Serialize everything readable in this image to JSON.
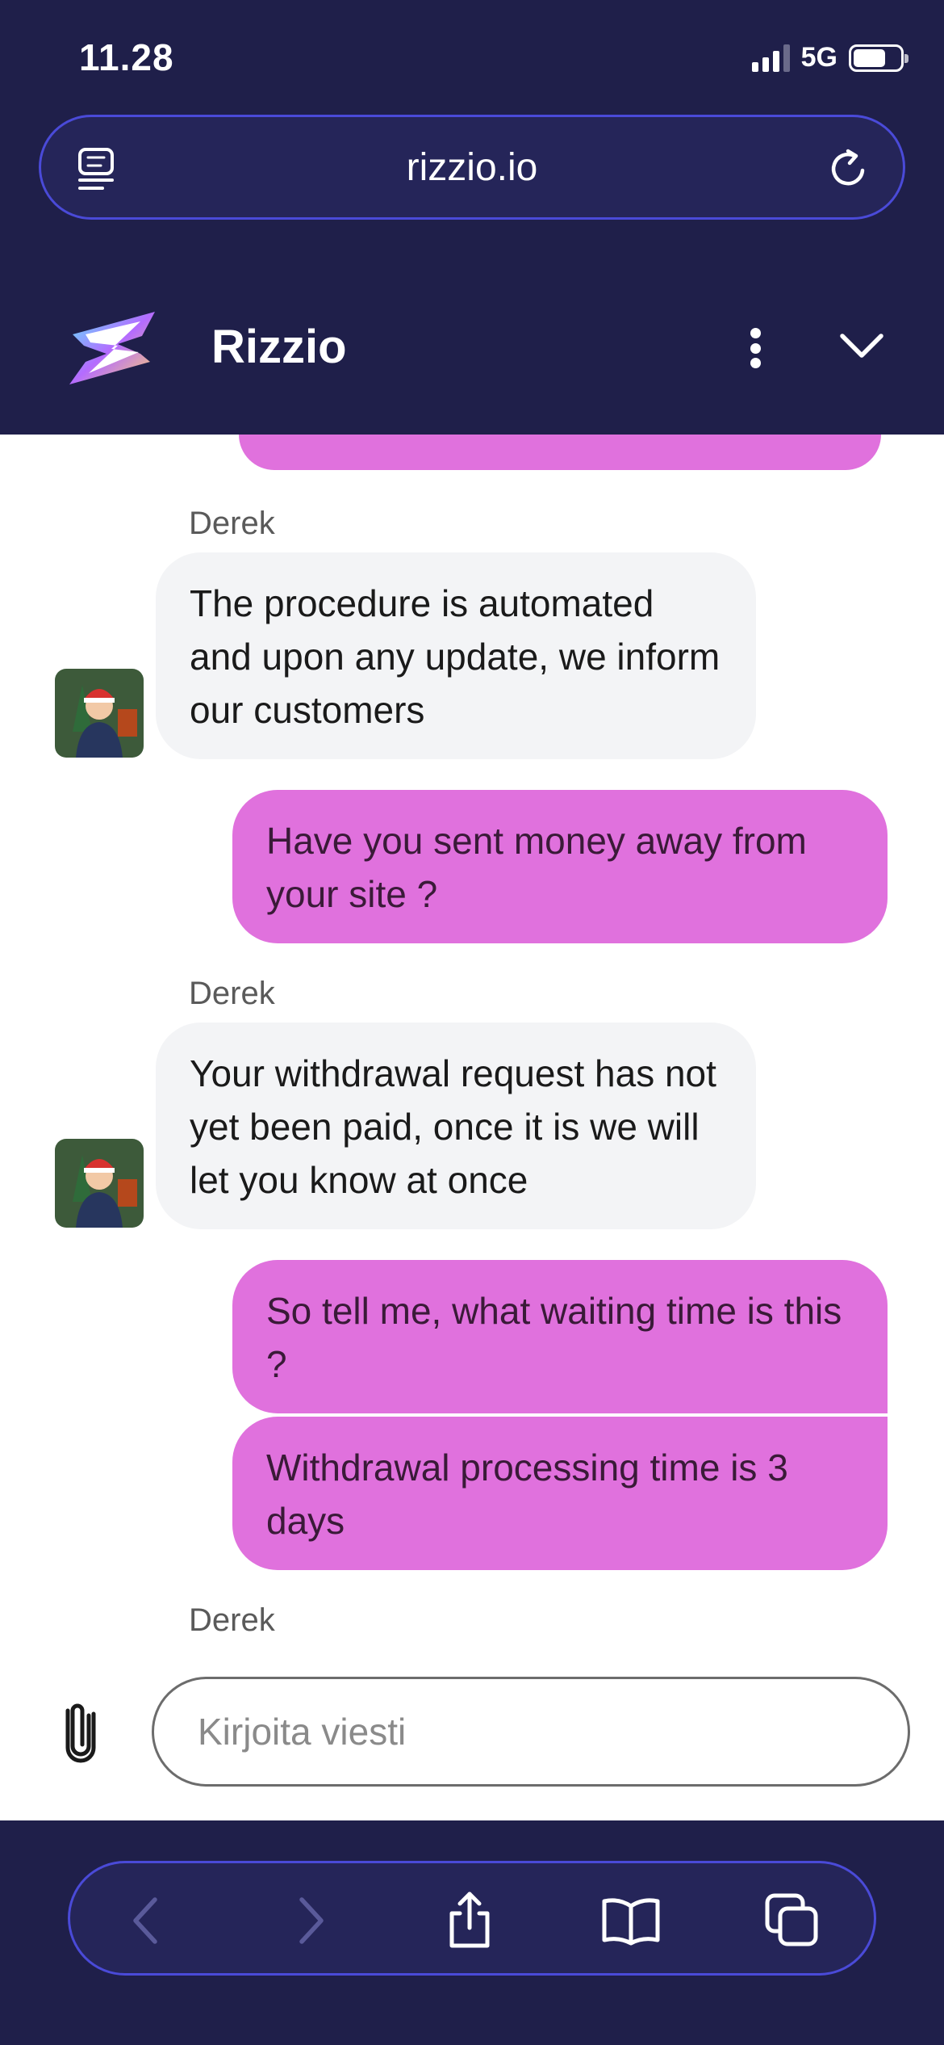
{
  "status_bar": {
    "time": "11.28",
    "network": "5G",
    "battery_level": 0.7,
    "signal_bars": 3
  },
  "browser": {
    "url": "rizzio.io"
  },
  "chat_header": {
    "title": "Rizzio"
  },
  "messages": [
    {
      "from": "agent",
      "sender": "Derek",
      "text": "The procedure is automated and upon any update, we inform our customers"
    },
    {
      "from": "user",
      "text": "Have you sent money away from your site ?"
    },
    {
      "from": "agent",
      "sender": "Derek",
      "text": "Your withdrawal request has not yet been paid, once it is we will let you know at once"
    },
    {
      "from": "user",
      "text": "So tell me, what waiting time is this ?"
    },
    {
      "from": "user",
      "text": "Withdrawal processing time is 3 days"
    },
    {
      "from": "agent",
      "sender": "Derek",
      "text": ""
    }
  ],
  "composer": {
    "placeholder": "Kirjoita viesti"
  },
  "icons": {
    "reader": "reader-icon",
    "reload": "reload-icon",
    "menu": "more-vertical-icon",
    "collapse": "chevron-down-icon",
    "attach": "paperclip-icon",
    "back": "chevron-left-icon",
    "forward": "chevron-right-icon",
    "share": "share-icon",
    "bookmarks": "book-icon",
    "tabs": "tabs-icon"
  },
  "colors": {
    "chrome_bg": "#1f1f4a",
    "accent_border": "#4a4ad8",
    "user_bubble": "#e071dd",
    "agent_bubble": "#f3f4f6"
  }
}
